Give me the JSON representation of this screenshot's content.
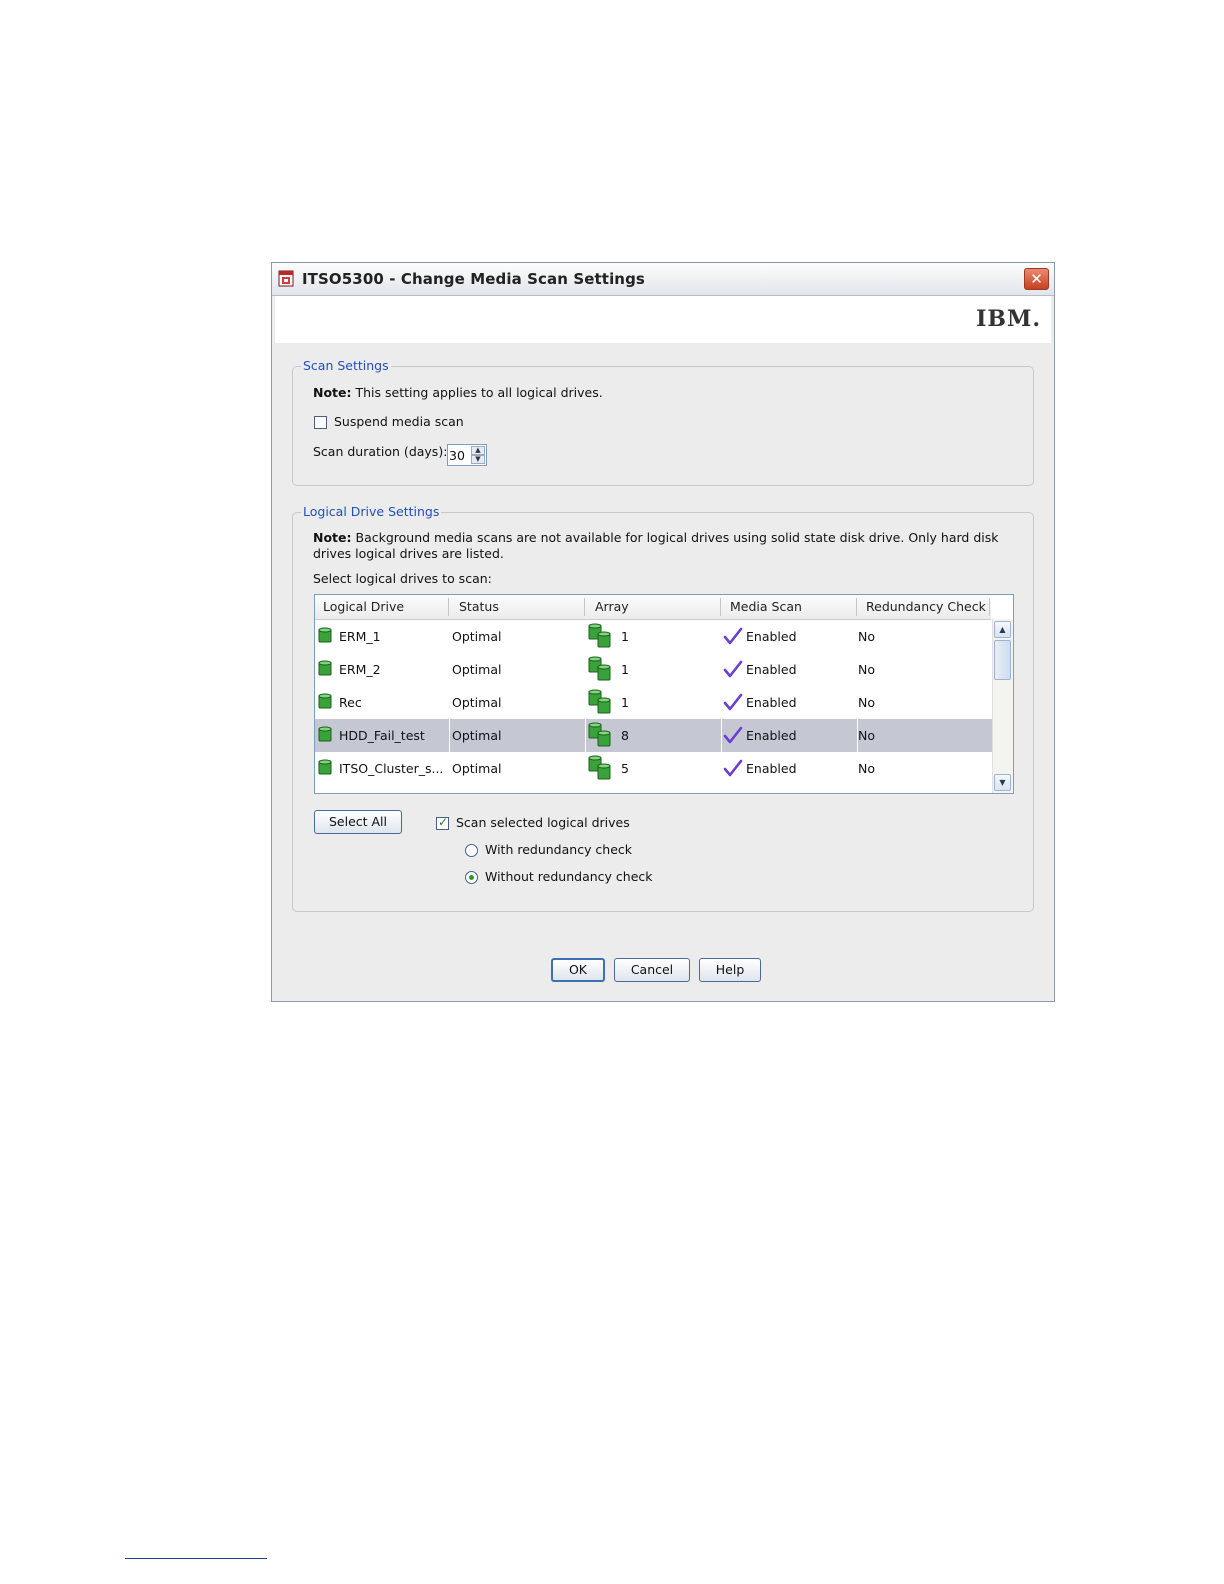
{
  "window": {
    "title": "ITSO5300 - Change Media Scan Settings",
    "brand": "IBM.",
    "close_glyph": "✕"
  },
  "scan_settings": {
    "legend": "Scan Settings",
    "note_bold": "Note:",
    "note_text": " This setting applies to all logical drives.",
    "suspend_label": "Suspend media scan",
    "suspend_checked": false,
    "duration_label": "Scan duration (days):",
    "duration_value": "30"
  },
  "logical_drive_settings": {
    "legend": "Logical Drive Settings",
    "note_bold": "Note:",
    "note_text": " Background media scans are not available for logical drives using solid state disk drive. Only hard disk drives logical drives are listed.",
    "select_label": "Select logical drives to scan:",
    "columns": [
      "Logical Drive",
      "Status",
      "Array",
      "Media Scan",
      "Redundancy Check"
    ],
    "rows": [
      {
        "drive": "ERM_1",
        "status": "Optimal",
        "array": "1",
        "media_scan": "Enabled",
        "redundancy": "No",
        "selected": false
      },
      {
        "drive": "ERM_2",
        "status": "Optimal",
        "array": "1",
        "media_scan": "Enabled",
        "redundancy": "No",
        "selected": false
      },
      {
        "drive": "Rec",
        "status": "Optimal",
        "array": "1",
        "media_scan": "Enabled",
        "redundancy": "No",
        "selected": false
      },
      {
        "drive": "HDD_Fail_test",
        "status": "Optimal",
        "array": "8",
        "media_scan": "Enabled",
        "redundancy": "No",
        "selected": true
      },
      {
        "drive": "ITSO_Cluster_s...",
        "status": "Optimal",
        "array": "5",
        "media_scan": "Enabled",
        "redundancy": "No",
        "selected": false
      }
    ],
    "select_all_label": "Select All",
    "scan_selected_label": "Scan selected logical drives",
    "scan_selected_checked": true,
    "with_redundancy_label": "With redundancy check",
    "without_redundancy_label": "Without redundancy check",
    "redundancy_choice": "without"
  },
  "buttons": {
    "ok": "OK",
    "cancel": "Cancel",
    "help": "Help"
  },
  "colors": {
    "legend_blue": "#1f4fbf",
    "selected_row": "#c5c8d2",
    "check_purple": "#6a3fd1",
    "drive_green": "#3aa23a"
  }
}
